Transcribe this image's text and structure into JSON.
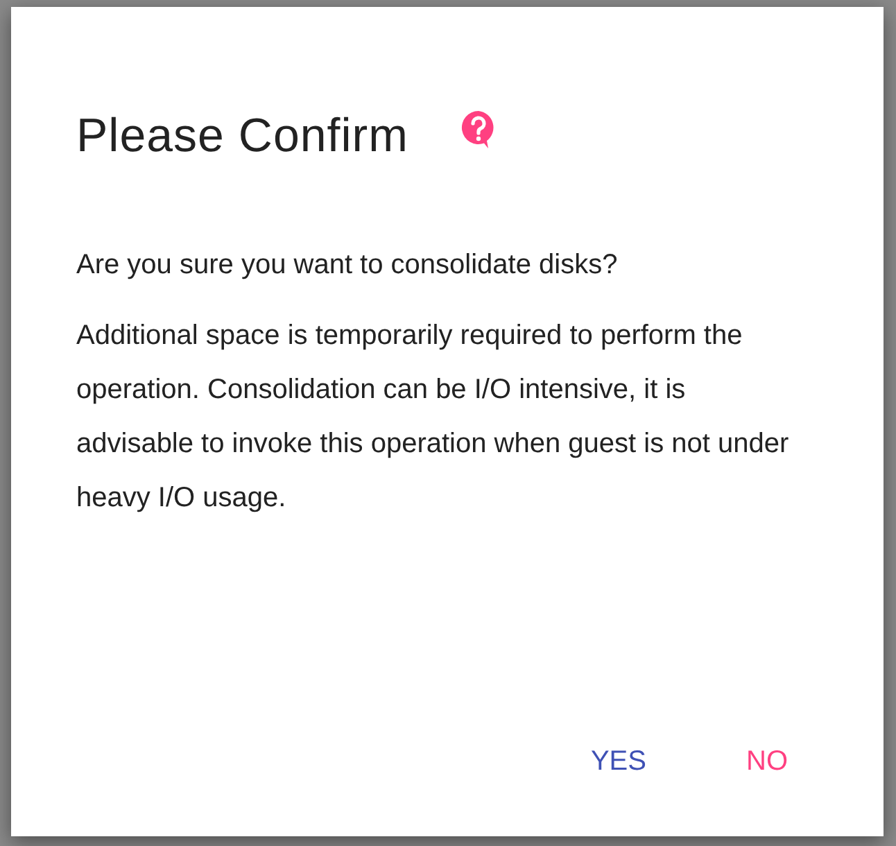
{
  "dialog": {
    "title": "Please Confirm",
    "question": "Are you sure you want to consolidate disks?",
    "message": "Additional space is temporarily required to perform the operation. Consolidation can be I/O intensive, it is advisable to invoke this operation when guest is not under heavy I/O usage.",
    "buttons": [
      {
        "label": "YES",
        "kind": "primary"
      },
      {
        "label": "NO",
        "kind": "danger"
      }
    ]
  }
}
